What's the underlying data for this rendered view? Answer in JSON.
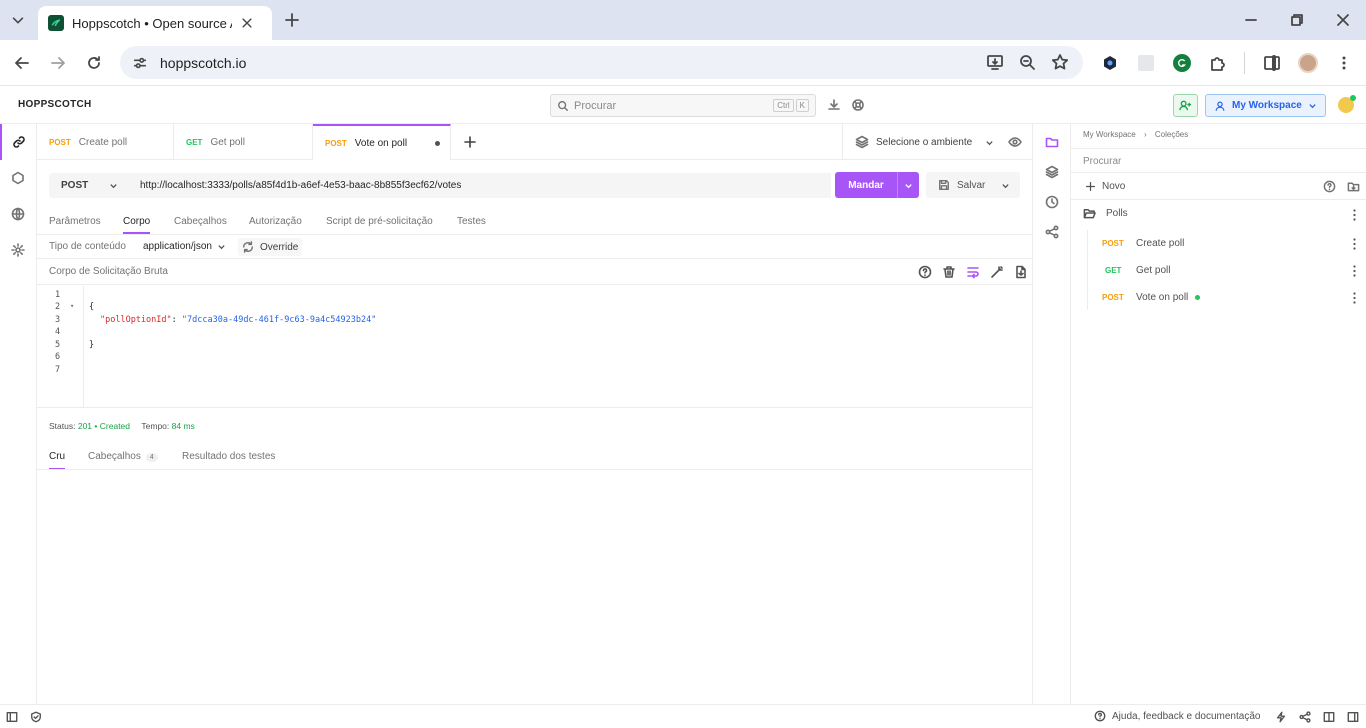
{
  "browser": {
    "tab_title": "Hoppscotch • Open source API",
    "url": "hoppscotch.io"
  },
  "app": {
    "logo": "HOPPSCOTCH",
    "search_placeholder": "Procurar",
    "kbd1": "Ctrl",
    "kbd2": "K",
    "workspace": "My Workspace"
  },
  "tabs": [
    {
      "method": "POST",
      "name": "Create poll"
    },
    {
      "method": "GET",
      "name": "Get poll"
    },
    {
      "method": "POST",
      "name": "Vote on poll"
    }
  ],
  "environment": "Selecione o ambiente",
  "request": {
    "method": "POST",
    "url": "http://localhost:3333/polls/a85f4d1b-a6ef-4e53-baac-8b855f3ecf62/votes",
    "send": "Mandar",
    "save": "Salvar"
  },
  "subtabs": [
    "Parâmetros",
    "Corpo",
    "Cabeçalhos",
    "Autorização",
    "Script de pré-solicitação",
    "Testes"
  ],
  "body": {
    "content_type_label": "Tipo de conteúdo",
    "content_type": "application/json",
    "override": "Override",
    "raw_label": "Corpo de Solicitação Bruta",
    "line_numbers": [
      "1",
      "2",
      "3",
      "4",
      "5",
      "6",
      "7"
    ],
    "open_brace": "{",
    "json_key": "\"pollOptionId\"",
    "colon": ": ",
    "json_value": "\"7dcca30a-49dc-461f-9c63-9a4c54923b24\"",
    "close_brace": "}"
  },
  "response": {
    "status_label": "Status:",
    "status_code": "201",
    "status_sep": "•",
    "status_text": "Created",
    "time_label": "Tempo:",
    "time_value": "84 ms",
    "tabs": [
      "Cru",
      "Cabeçalhos",
      "Resultado dos testes"
    ],
    "headers_count": "4"
  },
  "collections": {
    "crumb1": "My Workspace",
    "crumb_sep": "›",
    "crumb2": "Coleções",
    "search_placeholder": "Procurar",
    "new": "Novo",
    "folder": "Polls",
    "items": [
      {
        "method": "POST",
        "name": "Create poll"
      },
      {
        "method": "GET",
        "name": "Get poll"
      },
      {
        "method": "POST",
        "name": "Vote on poll"
      }
    ]
  },
  "footer": {
    "help": "Ajuda, feedback e documentação"
  },
  "colors": {
    "accent": "#a855f7",
    "post": "#f59e0b",
    "get": "#22c55e"
  }
}
